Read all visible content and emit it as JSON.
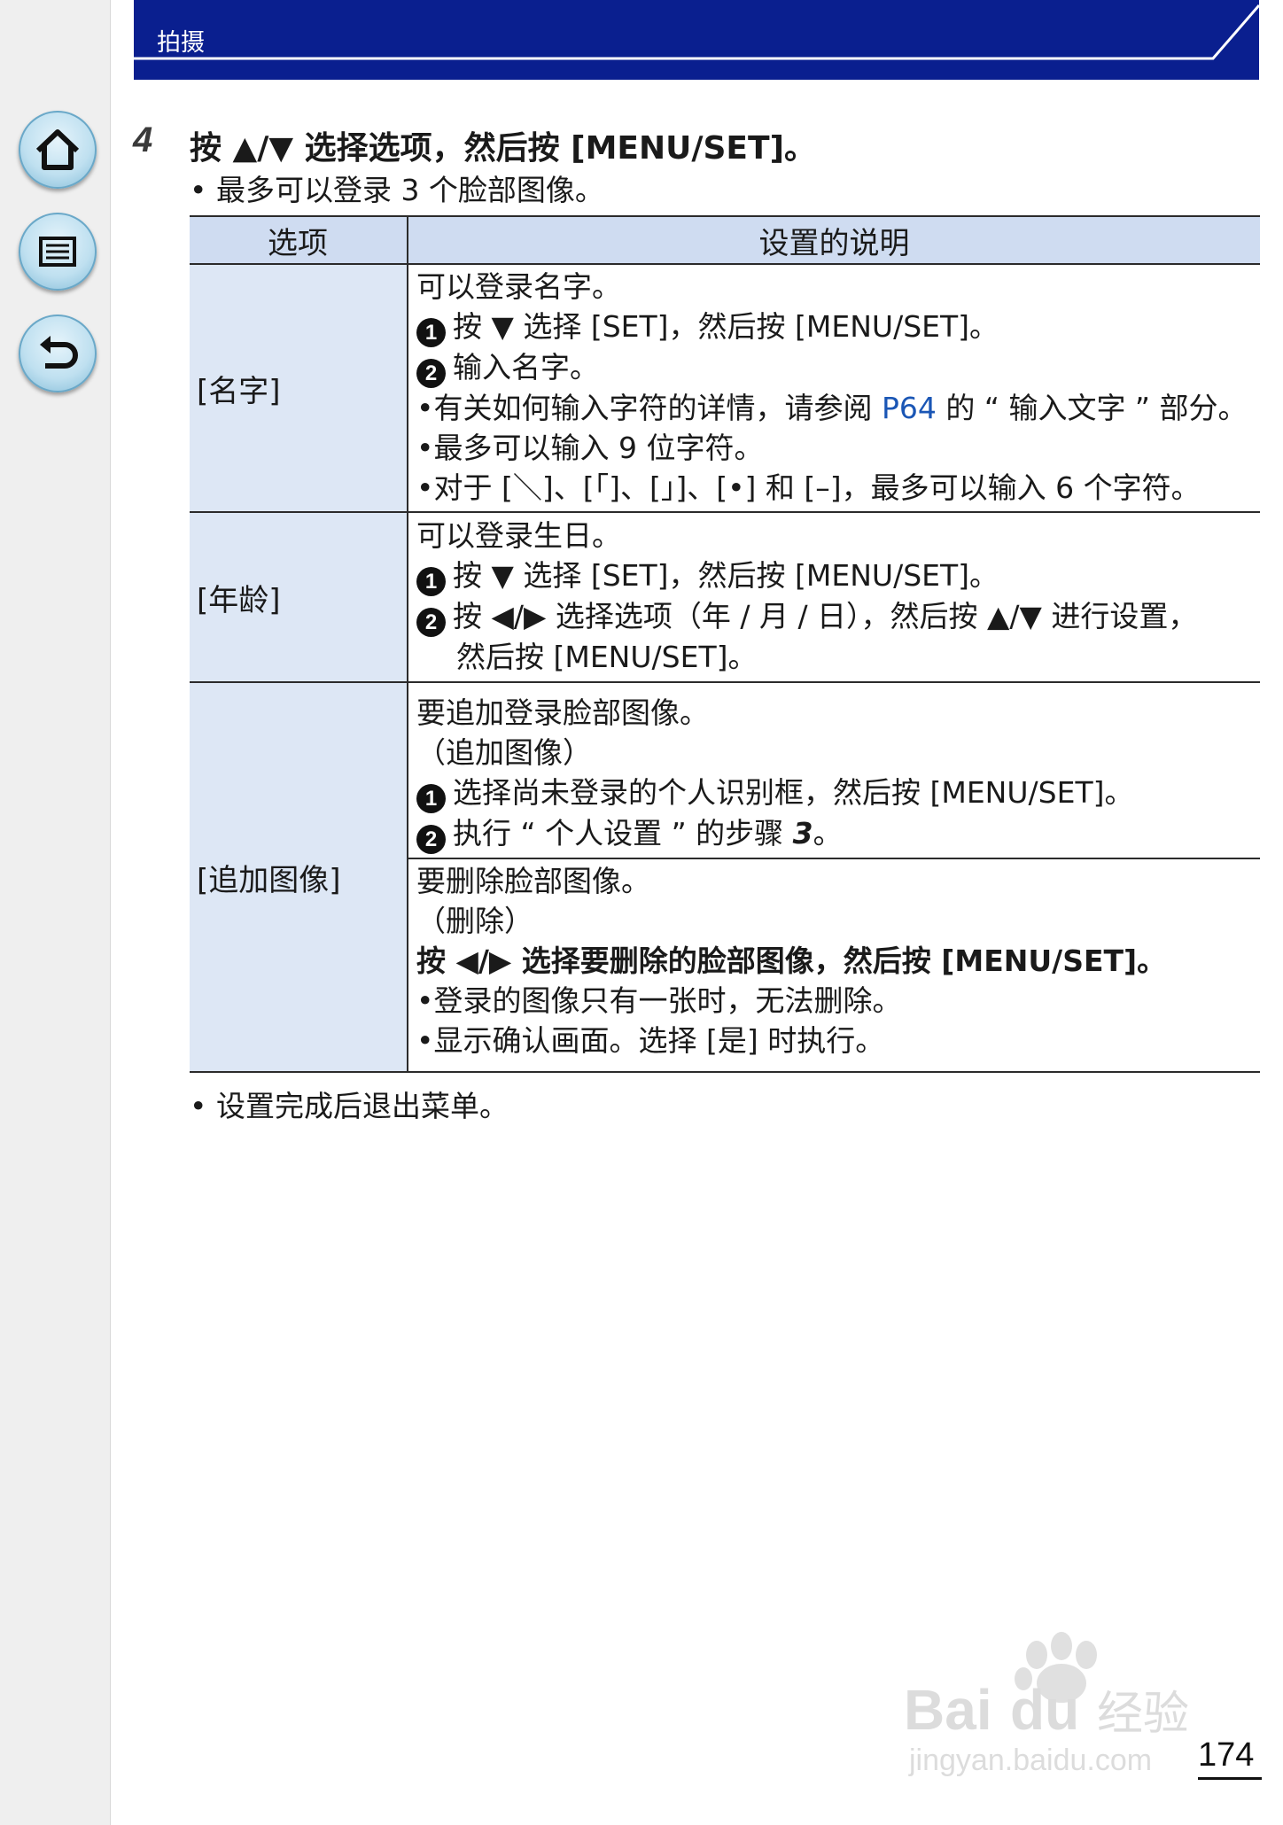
{
  "header": {
    "title": "拍摄"
  },
  "nav": {
    "home_icon": "home-icon",
    "menu_icon": "menu-list-icon",
    "back_icon": "back-arrow-icon"
  },
  "step": {
    "number": "4",
    "instruction": "按 ▲/▼ 选择选项，然后按 [MENU/SET]。",
    "note": "• 最多可以登录 3 个脸部图像。"
  },
  "table": {
    "headers": [
      "选项",
      "设置的说明"
    ],
    "rows": [
      {
        "option": "[名字]",
        "lines": [
          "可以登录名字。",
          "按 ▼ 选择 [SET]，然后按 [MENU/SET]。",
          "输入名字。",
          "•有关如何输入字符的详情，请参阅 ",
          "P64",
          " 的 “ 输入文字 ” 部分。",
          "•最多可以输入 9 位字符。",
          "•对于 [＼]、[「]、[」]、[•] 和 [–]，最多可以输入 6 个字符。"
        ]
      },
      {
        "option": "[年龄]",
        "lines": [
          "可以登录生日。",
          "按 ▼ 选择 [SET]，然后按 [MENU/SET]。",
          "按 ◀/▶ 选择选项（年 / 月 / 日），然后按 ▲/▼ 进行设置，",
          "然后按 [MENU/SET]。"
        ]
      },
      {
        "option": "[追加图像]",
        "add_lines": [
          "要追加登录脸部图像。",
          "（追加图像）",
          "选择尚未登录的个人识别框，然后按 [MENU/SET]。",
          "执行 “ 个人设置 ” 的步骤 ",
          "3",
          "。"
        ],
        "delete_lines": [
          "要删除脸部图像。",
          "（删除）",
          "按 ◀/▶ 选择要删除的脸部图像，然后按 [MENU/SET]。",
          "•登录的图像只有一张时，无法删除。",
          "•显示确认画面。选择 [是] 时执行。"
        ]
      }
    ],
    "circled_numbers": [
      "1",
      "2"
    ]
  },
  "footer_note": "• 设置完成后退出菜单。",
  "watermark": {
    "brand": "Bai",
    "brand2": "du",
    "cn": "经验",
    "url": "jingyan.baidu.com"
  },
  "page_number": "174",
  "colors": {
    "header_bg": "#0a1f8f",
    "table_header_bg": "#cfdcf1",
    "link": "#1a56b5"
  }
}
